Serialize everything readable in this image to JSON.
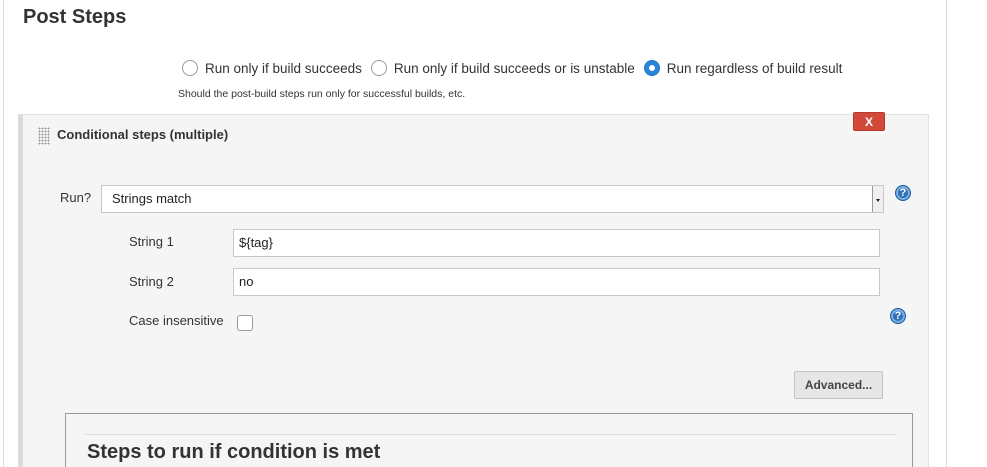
{
  "section": {
    "title": "Post Steps"
  },
  "post_steps": {
    "options": [
      {
        "label": "Run only if build succeeds",
        "selected": false
      },
      {
        "label": "Run only if build succeeds or is unstable",
        "selected": false
      },
      {
        "label": "Run regardless of build result",
        "selected": true
      }
    ],
    "help_text": "Should the post-build steps run only for successful builds, etc."
  },
  "conditional": {
    "title": "Conditional steps (multiple)",
    "delete_label": "X",
    "run_label": "Run?",
    "run_value": "Strings match",
    "string1_label": "String 1",
    "string1_value": "${tag}",
    "string2_label": "String 2",
    "string2_value": "no",
    "case_label": "Case insensitive",
    "case_checked": false,
    "advanced_label": "Advanced...",
    "steps_title": "Steps to run if condition is met"
  },
  "icons": {
    "help": "help-icon",
    "drag": "drag-handle-icon"
  },
  "colors": {
    "accent": "#2a84d8",
    "delete": "#d24939"
  }
}
